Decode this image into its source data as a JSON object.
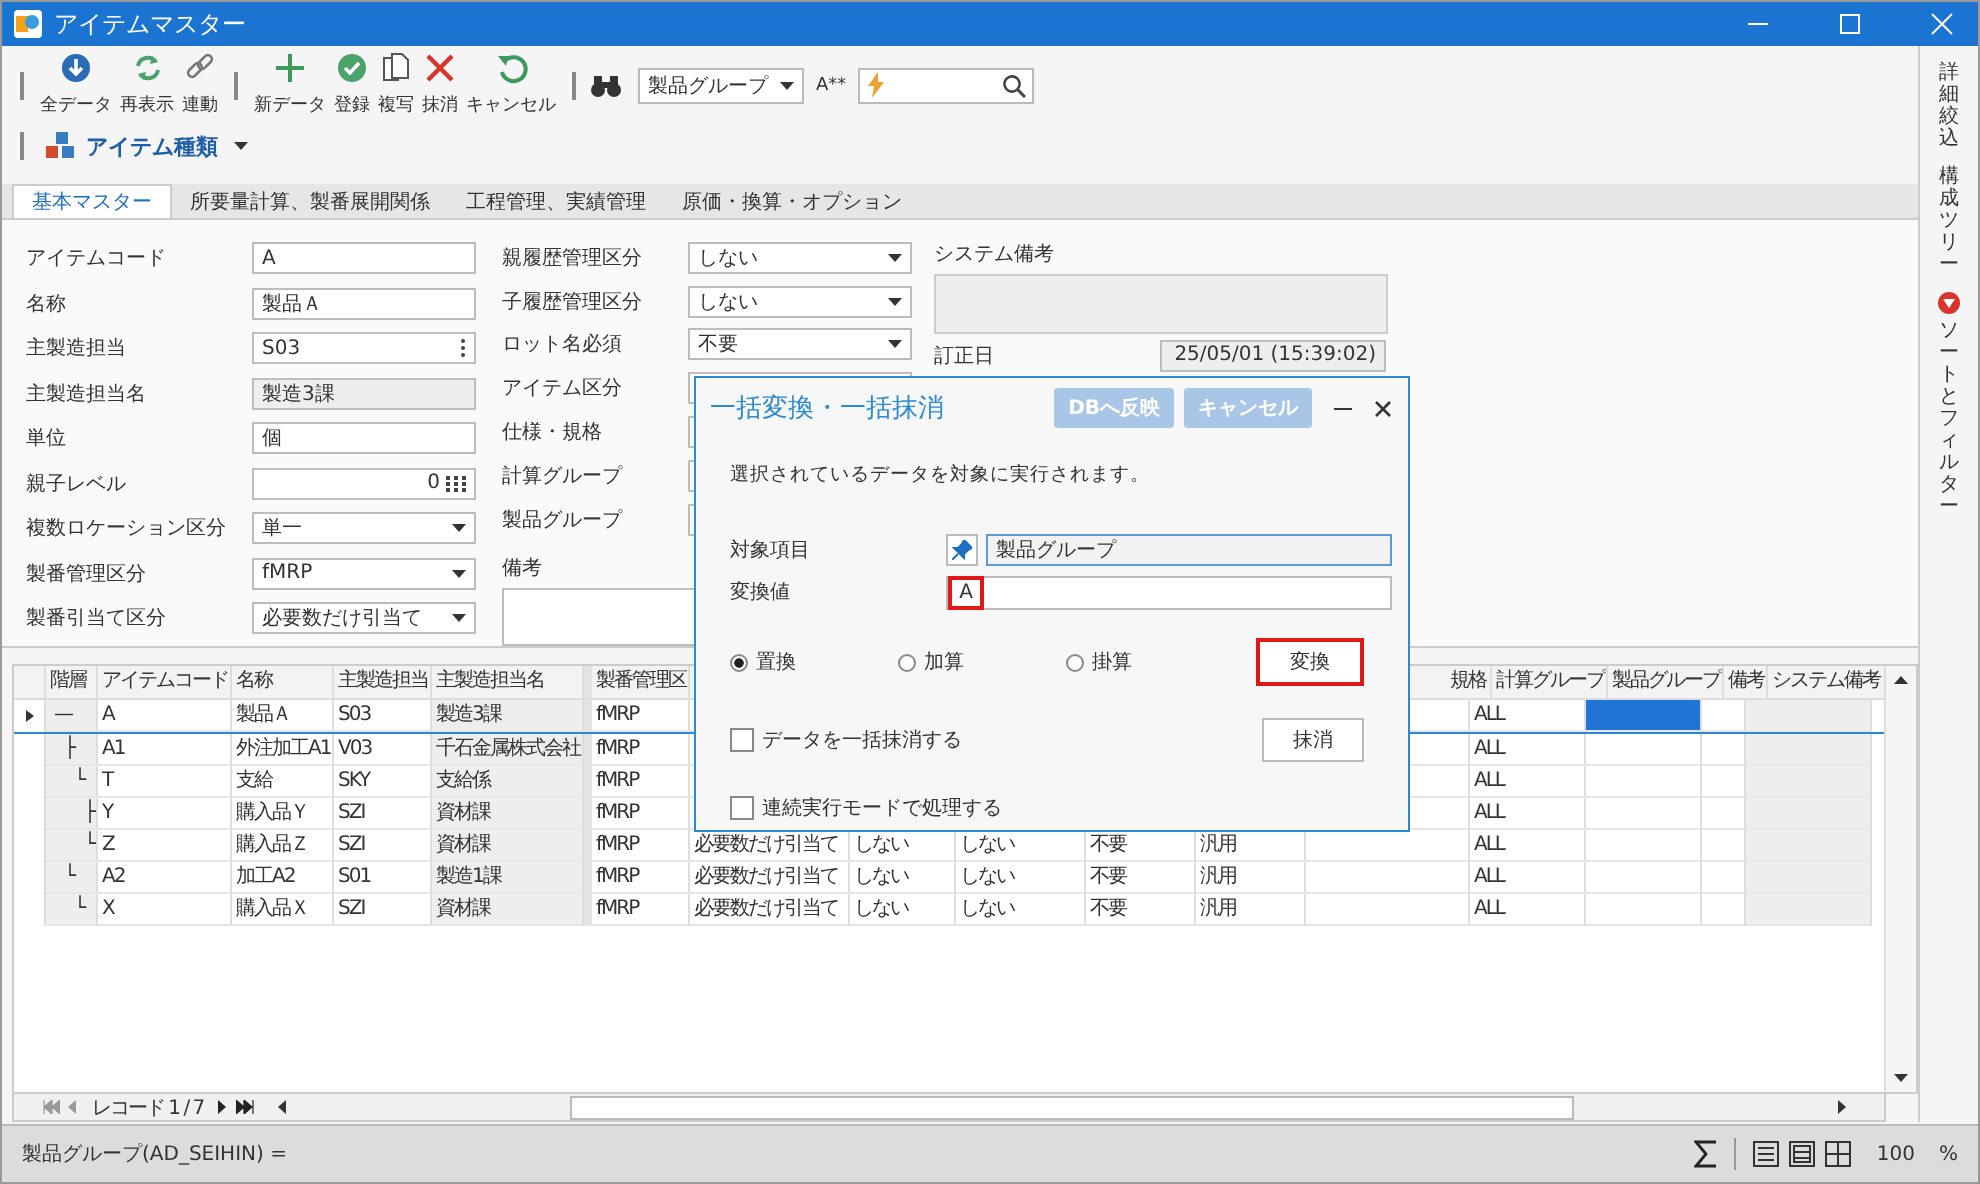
{
  "window": {
    "title": "アイテムマスター"
  },
  "toolbar": {
    "groups": [
      [
        {
          "label": "全データ"
        },
        {
          "label": "再表示"
        },
        {
          "label": "連動"
        }
      ],
      [
        {
          "label": "新データ"
        },
        {
          "label": "登録"
        },
        {
          "label": "複写"
        },
        {
          "label": "抹消"
        },
        {
          "label": "キャンセル"
        }
      ]
    ],
    "field_dropdown": {
      "value": "製品グループ"
    },
    "match_label": "A**",
    "item_type_menu": {
      "label": "アイテム種類"
    }
  },
  "tabs": [
    {
      "label": "基本マスター",
      "selected": true
    },
    {
      "label": "所要量計算、製番展開関係",
      "selected": false
    },
    {
      "label": "工程管理、実績管理",
      "selected": false
    },
    {
      "label": "原価・換算・オプション",
      "selected": false
    }
  ],
  "form": {
    "left": [
      {
        "label": "アイテムコード",
        "kind": "text",
        "value": "A"
      },
      {
        "label": "名称",
        "kind": "text",
        "value": "製品Ａ"
      },
      {
        "label": "主製造担当",
        "kind": "lookup",
        "value": "S03"
      },
      {
        "label": "主製造担当名",
        "kind": "readonly",
        "value": "製造3課"
      },
      {
        "label": "単位",
        "kind": "text",
        "value": "個"
      },
      {
        "label": "親子レベル",
        "kind": "number",
        "value": "0"
      },
      {
        "label": "複数ロケーション区分",
        "kind": "select",
        "value": "単一"
      },
      {
        "label": "製番管理区分",
        "kind": "select",
        "value": "fMRP"
      },
      {
        "label": "製番引当て区分",
        "kind": "select",
        "value": "必要数だけ引当て"
      }
    ],
    "middle": [
      {
        "label": "親履歴管理区分",
        "kind": "select",
        "value": "しない"
      },
      {
        "label": "子履歴管理区分",
        "kind": "select",
        "value": "しない"
      },
      {
        "label": "ロット名必須",
        "kind": "select",
        "value": "不要"
      },
      {
        "label": "アイテム区分",
        "kind": "select"
      },
      {
        "label": "仕様・規格",
        "kind": "text"
      },
      {
        "label": "計算グループ",
        "kind": "select"
      },
      {
        "label": "製品グループ",
        "kind": "select"
      }
    ],
    "memo": {
      "label": "備考"
    },
    "system_memo": {
      "label": "システム備考"
    },
    "revised": {
      "label": "訂正日",
      "value": "25/05/01 (15:39:02)"
    }
  },
  "dialog": {
    "title": "一括変換・一括抹消",
    "header_buttons": [
      {
        "label": "DBへ反映",
        "disabled": true
      },
      {
        "label": "キャンセル",
        "disabled": true
      }
    ],
    "message": "選択されているデータを対象に実行されます。",
    "target": {
      "label": "対象項目",
      "value": "製品グループ"
    },
    "new_value": {
      "label": "変換値",
      "value": "A",
      "highlighted": true
    },
    "modes": [
      {
        "label": "置換",
        "selected": true
      },
      {
        "label": "加算",
        "selected": false
      },
      {
        "label": "掛算",
        "selected": false
      }
    ],
    "convert_button": {
      "label": "変換",
      "highlighted": true
    },
    "options": [
      {
        "label": "データを一括抹消する",
        "checked": false
      },
      {
        "label": "連続実行モードで処理する",
        "checked": false
      }
    ],
    "delete_button": {
      "label": "抹消"
    }
  },
  "grid": {
    "columns": [
      {
        "label": "階層",
        "selected": false
      },
      {
        "label": "アイテムコード",
        "selected": false
      },
      {
        "label": "名称",
        "selected": false
      },
      {
        "label": "主製造担当",
        "selected": false
      },
      {
        "label": "主製造担当名",
        "selected": false
      },
      {
        "label": "製番管理区",
        "selected": false
      },
      {
        "selected": false
      },
      {
        "selected": false
      },
      {
        "selected": false
      },
      {
        "selected": false
      },
      {
        "selected": false
      },
      {
        "label": "規格",
        "selected": false
      },
      {
        "label": "計算グループ",
        "selected": false
      },
      {
        "label": "製品グループ",
        "selected": true
      },
      {
        "label": "備考",
        "selected": false
      },
      {
        "label": "システム備考",
        "selected": false
      }
    ],
    "rows": [
      {
        "selected": true,
        "cells": [
          "—",
          "A",
          "製品Ａ",
          "S03",
          "製造3課",
          "fMRP",
          null,
          null,
          null,
          null,
          null,
          null,
          "ALL",
          null,
          null,
          null
        ],
        "children": [
          {
            "selected": false,
            "cells": [
              "├",
              "A1",
              "外注加工A1",
              "V03",
              "千石金属株式会社",
              "fMRP",
              null,
              null,
              null,
              null,
              null,
              null,
              "ALL",
              null,
              null,
              null
            ],
            "children": [
              {
                "selected": false,
                "cells": [
                  "└",
                  "T",
                  "支給",
                  "SKY",
                  "支給係",
                  "fMRP",
                  null,
                  null,
                  null,
                  null,
                  null,
                  null,
                  "ALL",
                  null,
                  null,
                  null
                ],
                "children": [
                  {
                    "selected": false,
                    "cells": [
                      "├",
                      "Y",
                      "購入品Ｙ",
                      "SZI",
                      "資材課",
                      "fMRP",
                      null,
                      null,
                      null,
                      null,
                      null,
                      null,
                      "ALL",
                      null,
                      null,
                      null
                    ]
                  },
                  {
                    "selected": false,
                    "cells": [
                      "└",
                      "Z",
                      "購入品Ｚ",
                      "SZI",
                      "資材課",
                      "fMRP",
                      "必要数だけ引当て",
                      "しない",
                      "しない",
                      "不要",
                      "汎用",
                      null,
                      "ALL",
                      null,
                      null,
                      null
                    ]
                  }
                ]
              }
            ]
          },
          {
            "selected": false,
            "cells": [
              "└",
              "A2",
              "加工A2",
              "S01",
              "製造1課",
              "fMRP",
              "必要数だけ引当て",
              "しない",
              "しない",
              "不要",
              "汎用",
              null,
              "ALL",
              null,
              null,
              null
            ],
            "children": [
              {
                "selected": false,
                "cells": [
                  "└",
                  "X",
                  "購入品Ｘ",
                  "SZI",
                  "資材課",
                  "fMRP",
                  "必要数だけ引当て",
                  "しない",
                  "しない",
                  "不要",
                  "汎用",
                  null,
                  "ALL",
                  null,
                  null,
                  null
                ]
              }
            ]
          }
        ]
      }
    ]
  },
  "pager": {
    "text": "レコード 1 / 7"
  },
  "status_bar": {
    "text": "製品グループ(AD_SEIHIN) =",
    "zoom": "100",
    "unit": "%"
  },
  "side_panel": {
    "items": [
      {
        "label": "詳細絞込",
        "filter_active": false
      },
      {
        "label": "構成ツリー",
        "filter_active": false
      },
      {
        "label": "ソートとフィルター",
        "filter_active": true
      }
    ]
  }
}
